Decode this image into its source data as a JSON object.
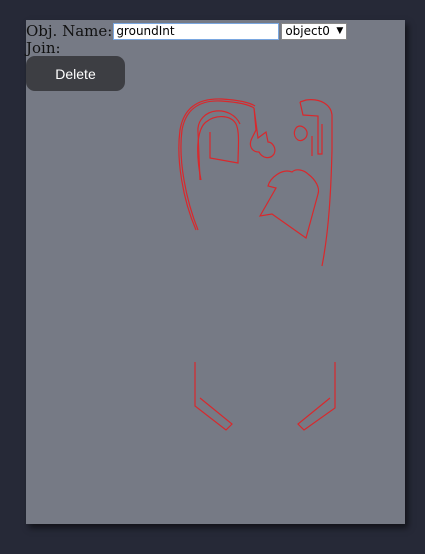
{
  "form": {
    "obj_name_label": "Obj. Name:",
    "obj_name_value": "groundInt",
    "object_select_value": "object0",
    "join_label": "Join:"
  },
  "toolbar": {
    "delete_label": "Delete"
  },
  "colors": {
    "panel": "#767a85",
    "background": "#262937",
    "shape_stroke": "#d9282c",
    "button": "#3d3e43"
  }
}
